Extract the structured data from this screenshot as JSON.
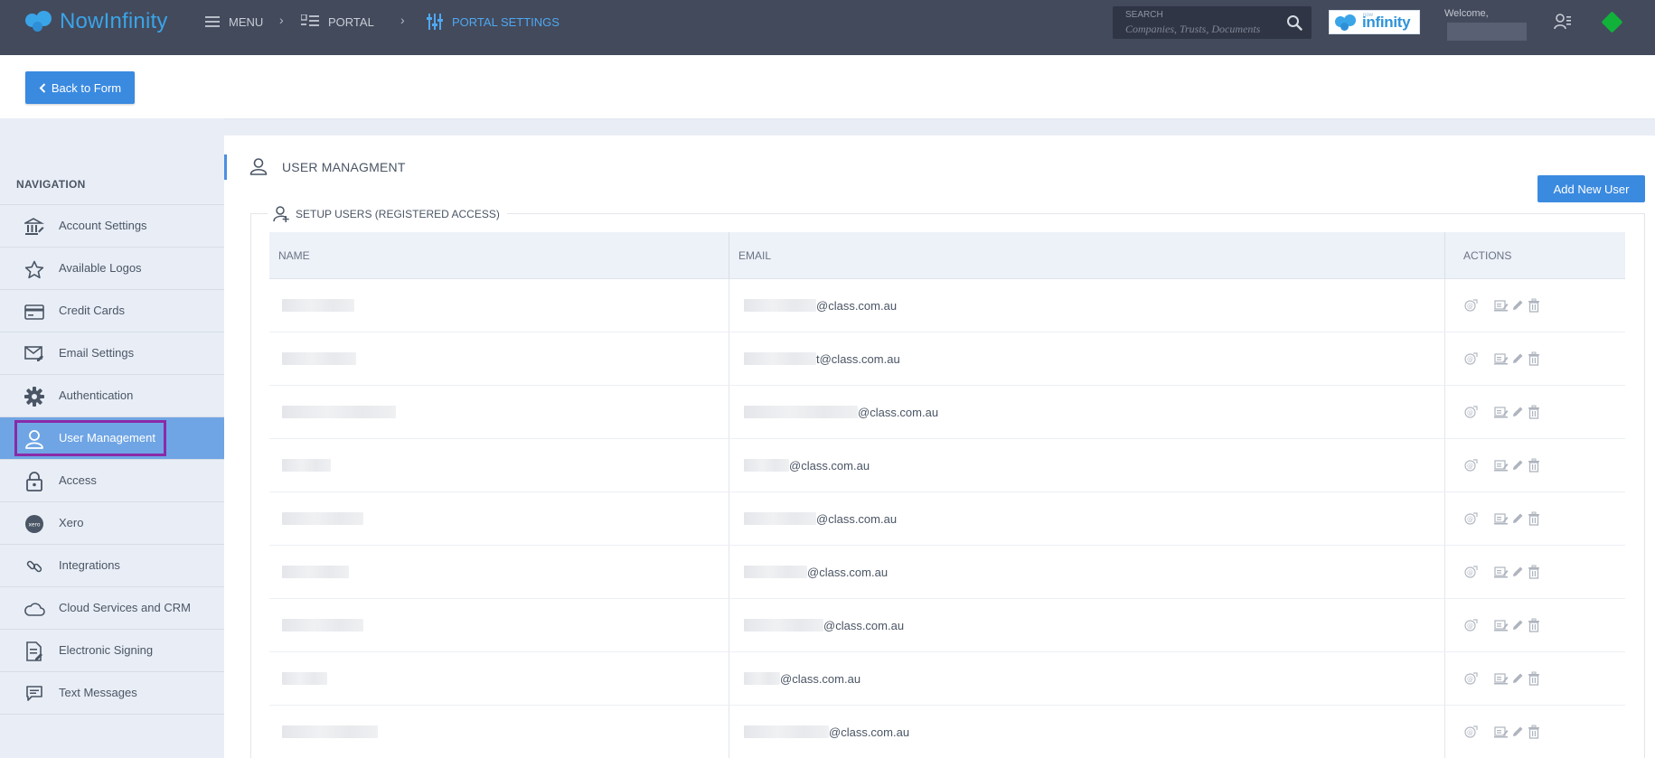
{
  "app": {
    "logo_text": "NowInfinity"
  },
  "topbar": {
    "breadcrumbs": [
      {
        "label": "MENU",
        "icon": "menu-icon"
      },
      {
        "label": "PORTAL",
        "icon": "portal-list-icon"
      },
      {
        "label": "PORTAL SETTINGS",
        "icon": "sliders-icon"
      }
    ],
    "search": {
      "label": "SEARCH",
      "placeholder": "Companies, Trusts, Documents"
    },
    "brand_badge_text": "infinity",
    "brand_badge_small": "now",
    "welcome_label": "Welcome,",
    "accent_color": "#4fa8f0",
    "status_color": "#11b23a"
  },
  "backbar": {
    "back_label": "Back to Form"
  },
  "sidebar": {
    "heading": "NAVIGATION",
    "items": [
      {
        "label": "Account Settings",
        "icon": "bank-icon"
      },
      {
        "label": "Available Logos",
        "icon": "star-icon"
      },
      {
        "label": "Credit Cards",
        "icon": "credit-card-icon"
      },
      {
        "label": "Email Settings",
        "icon": "envelope-icon"
      },
      {
        "label": "Authentication",
        "icon": "gear-icon"
      },
      {
        "label": "User Management",
        "icon": "user-icon",
        "active": true
      },
      {
        "label": "Access",
        "icon": "lock-icon"
      },
      {
        "label": "Xero",
        "icon": "xero-icon"
      },
      {
        "label": "Integrations",
        "icon": "link-icon"
      },
      {
        "label": "Cloud Services and CRM",
        "icon": "cloud-icon"
      },
      {
        "label": "Electronic Signing",
        "icon": "signed-document-icon"
      },
      {
        "label": "Text Messages",
        "icon": "chat-icon"
      }
    ]
  },
  "main": {
    "title": "USER MANAGMENT",
    "add_button_label": "Add New User",
    "section_title": "SETUP USERS (REGISTERED ACCESS)",
    "table": {
      "headers": {
        "name": "NAME",
        "email": "EMAIL",
        "actions": "ACTIONS"
      },
      "rows": [
        {
          "email_domain": "@class.com.au"
        },
        {
          "email_domain": "t@class.com.au"
        },
        {
          "email_domain": "@class.com.au"
        },
        {
          "email_domain": "@class.com.au"
        },
        {
          "email_domain": "@class.com.au"
        },
        {
          "email_domain": "@class.com.au"
        },
        {
          "email_domain": "@class.com.au"
        },
        {
          "email_domain": "@class.com.au"
        },
        {
          "email_domain": "@class.com.au"
        }
      ],
      "action_icons": [
        "resend-invite-icon",
        "permissions-icon",
        "edit-pencil-icon",
        "delete-trash-icon"
      ]
    }
  }
}
